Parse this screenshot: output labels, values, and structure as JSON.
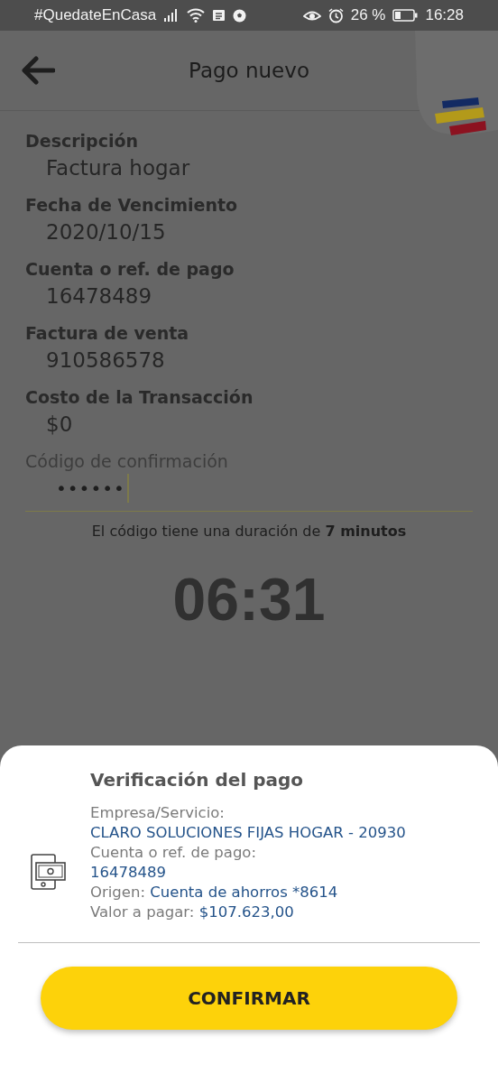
{
  "status_bar": {
    "hashtag": "#QuedateEnCasa",
    "battery": "26 %",
    "time": "16:28"
  },
  "app_bar": {
    "title": "Pago nuevo"
  },
  "fields": [
    {
      "label": "Descripción",
      "value": "Factura hogar"
    },
    {
      "label": "Fecha de Vencimiento",
      "value": "2020/10/15"
    },
    {
      "label": "Cuenta o ref. de pago",
      "value": "16478489"
    },
    {
      "label": "Factura de venta",
      "value": "910586578"
    },
    {
      "label": "Costo de la Transacción",
      "value": "$0"
    }
  ],
  "code_field": {
    "label": "Código de confirmación",
    "value": "••••••"
  },
  "hint": "El código tiene una duración de **7 minutos**",
  "timer": "06:31",
  "sheet": {
    "title": "Verificación del pago",
    "details": [
      {
        "label": "Empresa/Servicio:",
        "value": "CLARO SOLUCIONES FIJAS HOGAR - 20930",
        "kind": "stacked"
      },
      {
        "label": "Cuenta o ref. de pago:",
        "value": "16478489",
        "kind": "stacked"
      },
      {
        "label": "Origen:",
        "value": "Cuenta de ahorros *8614",
        "kind": "inline"
      },
      {
        "label": "Valor a pagar:",
        "value": "$107.623,00",
        "kind": "inline"
      }
    ],
    "button": "CONFIRMAR"
  }
}
